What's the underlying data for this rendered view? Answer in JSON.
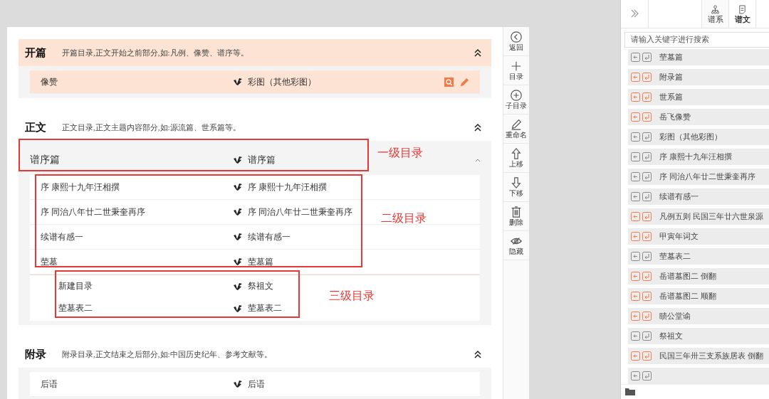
{
  "sections": [
    {
      "title": "开篇",
      "description": "开篇目录,正文开始之前部分,如:凡例、像赞、谱序等。",
      "selected": true,
      "items": [
        {
          "name": "像赞",
          "template": "彩图（其他彩图）",
          "selected": true
        }
      ]
    },
    {
      "title": "正文",
      "description": "正文目录,正文主题内容部分,如:源流篇、世系篇等。",
      "selected": false,
      "items": [
        {
          "name": "谱序篇",
          "template": "谱序篇",
          "selected": false,
          "children": [
            {
              "name": "序 康熙十九年汪相撰",
              "template": "序 康熙十九年汪相撰",
              "selected": false
            },
            {
              "name": "序 同治八年廿二世秉奎再序",
              "template": "序 同治八年廿二世秉奎再序",
              "selected": false
            },
            {
              "name": "续谱有感一",
              "template": "续谱有感一",
              "selected": false
            },
            {
              "name": "茔墓",
              "template": "茔墓篇",
              "selected": false,
              "children": [
                {
                  "name": "新建目录",
                  "template": "祭祖文",
                  "selected": false
                },
                {
                  "name": "茔墓表二",
                  "template": "茔墓表二",
                  "selected": false
                }
              ]
            }
          ]
        }
      ]
    },
    {
      "title": "附录",
      "description": "附录目录,正文结束之后部分,如:中国历史纪年、参考文献等。",
      "selected": false,
      "items": [
        {
          "name": "后语",
          "template": "后语",
          "selected": false
        }
      ]
    }
  ],
  "annotations": [
    {
      "label": "一级目录"
    },
    {
      "label": "二级目录"
    },
    {
      "label": "三级目录"
    }
  ],
  "toolbar": [
    {
      "kind": "back",
      "label": "返回"
    },
    {
      "kind": "add",
      "label": "目录"
    },
    {
      "kind": "add-child",
      "label": "子目录"
    },
    {
      "kind": "rename",
      "label": "重命名"
    },
    {
      "kind": "up",
      "label": "上移"
    },
    {
      "kind": "down",
      "label": "下移"
    },
    {
      "kind": "delete",
      "label": "删除"
    },
    {
      "kind": "hide",
      "label": "隐藏"
    }
  ],
  "side_panel": {
    "tabs": [
      {
        "kind": "tree",
        "label": "谱系",
        "selected": false
      },
      {
        "kind": "doc",
        "label": "谱文",
        "selected": true
      }
    ],
    "search": {
      "placeholder": "请输入关键字进行搜索"
    },
    "items": [
      {
        "label": "茔墓篇",
        "highlighted": false
      },
      {
        "label": "附录篇",
        "highlighted": true
      },
      {
        "label": "世系篇",
        "highlighted": true
      },
      {
        "label": "岳飞像赞",
        "highlighted": true
      },
      {
        "label": "彩图（其他彩图）",
        "highlighted": false
      },
      {
        "label": "序 康熙十九年汪相撰",
        "highlighted": false
      },
      {
        "label": "序 同治八年廿二世秉奎再序",
        "highlighted": false
      },
      {
        "label": "续谱有感一",
        "highlighted": false
      },
      {
        "label": "凡例五则 民国三年廿六世泉源",
        "highlighted": true
      },
      {
        "label": "甲寅年词文",
        "highlighted": true
      },
      {
        "label": "茔墓表二",
        "highlighted": false
      },
      {
        "label": "岳谱墓图二 倒翻",
        "highlighted": true
      },
      {
        "label": "岳谱墓图二 顺翻",
        "highlighted": true
      },
      {
        "label": "赜公堂谕",
        "highlighted": true
      },
      {
        "label": "祭祖文",
        "highlighted": false
      },
      {
        "label": "民国三年卅三支系族居表 倒翻",
        "highlighted": true
      },
      {
        "highlighted": false
      }
    ]
  }
}
